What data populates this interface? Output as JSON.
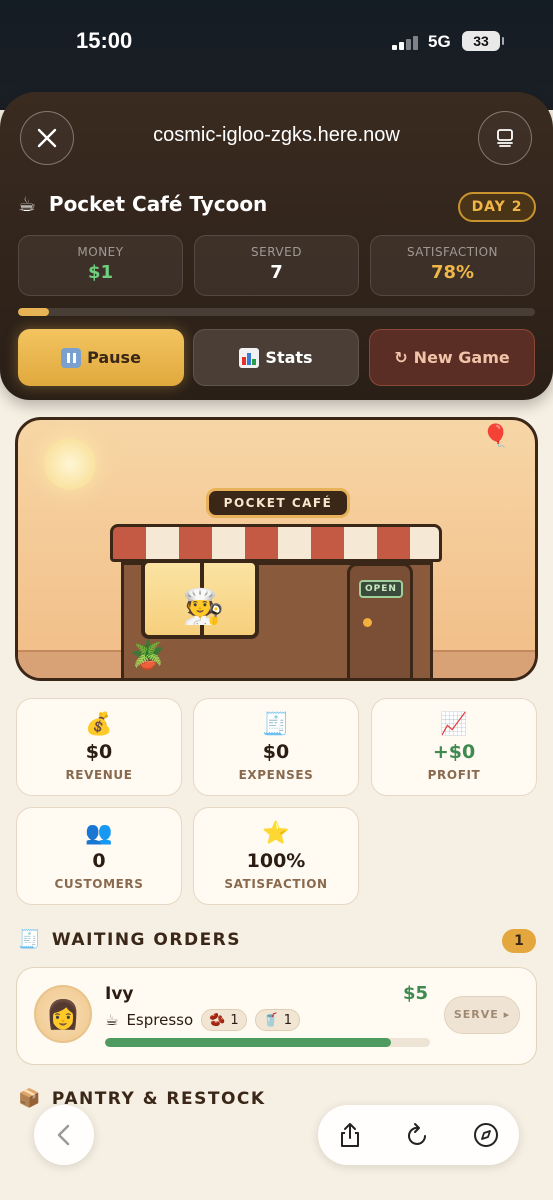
{
  "status_bar": {
    "time": "15:00",
    "network": "5G",
    "battery": "33"
  },
  "browser": {
    "url": "cosmic-igloo-zgks.here.now"
  },
  "game": {
    "title": "Pocket Café Tycoon",
    "day_label": "DAY 2",
    "metrics": [
      {
        "label": "MONEY",
        "value": "$1",
        "color": "#6fcf7f"
      },
      {
        "label": "SERVED",
        "value": "7",
        "color": "#ffffff"
      },
      {
        "label": "SATISFACTION",
        "value": "78%",
        "color": "#f0b647"
      }
    ],
    "day_progress": 0.06,
    "controls": {
      "pause": "Pause",
      "stats": "Stats",
      "new_game": "New Game",
      "new_game_symbol": "↻"
    }
  },
  "scene": {
    "sign": "POCKET CAFÉ",
    "door_sign": "OPEN",
    "window_emoji": "🧑‍🍳",
    "plant_emoji": "🪴",
    "balloon_emoji": "🎈"
  },
  "stats_cards": [
    {
      "icon": "💰",
      "value": "$0",
      "label": "REVENUE",
      "value_color": "#2b1d12"
    },
    {
      "icon": "🧾",
      "value": "$0",
      "label": "EXPENSES",
      "value_color": "#2b1d12"
    },
    {
      "icon": "📈",
      "value": "+$0",
      "label": "PROFIT",
      "value_color": "#3e8a50"
    },
    {
      "icon": "👥",
      "value": "0",
      "label": "CUSTOMERS",
      "value_color": "#2b1d12"
    },
    {
      "icon": "⭐",
      "value": "100%",
      "label": "SATISFACTION",
      "value_color": "#2b1d12"
    }
  ],
  "waiting_orders": {
    "title": "WAITING ORDERS",
    "icon": "🧾",
    "count": "1",
    "orders": [
      {
        "avatar": "👩",
        "name": "Ivy",
        "price": "$5",
        "drink_icon": "☕",
        "drink": "Espresso",
        "ingredients": [
          {
            "icon": "🫘",
            "qty": "1"
          },
          {
            "icon": "🥤",
            "qty": "1"
          }
        ],
        "patience": 0.88,
        "serve_label": "SERVE ▸"
      }
    ]
  },
  "pantry": {
    "title": "PANTRY & RESTOCK",
    "icon": "📦"
  }
}
